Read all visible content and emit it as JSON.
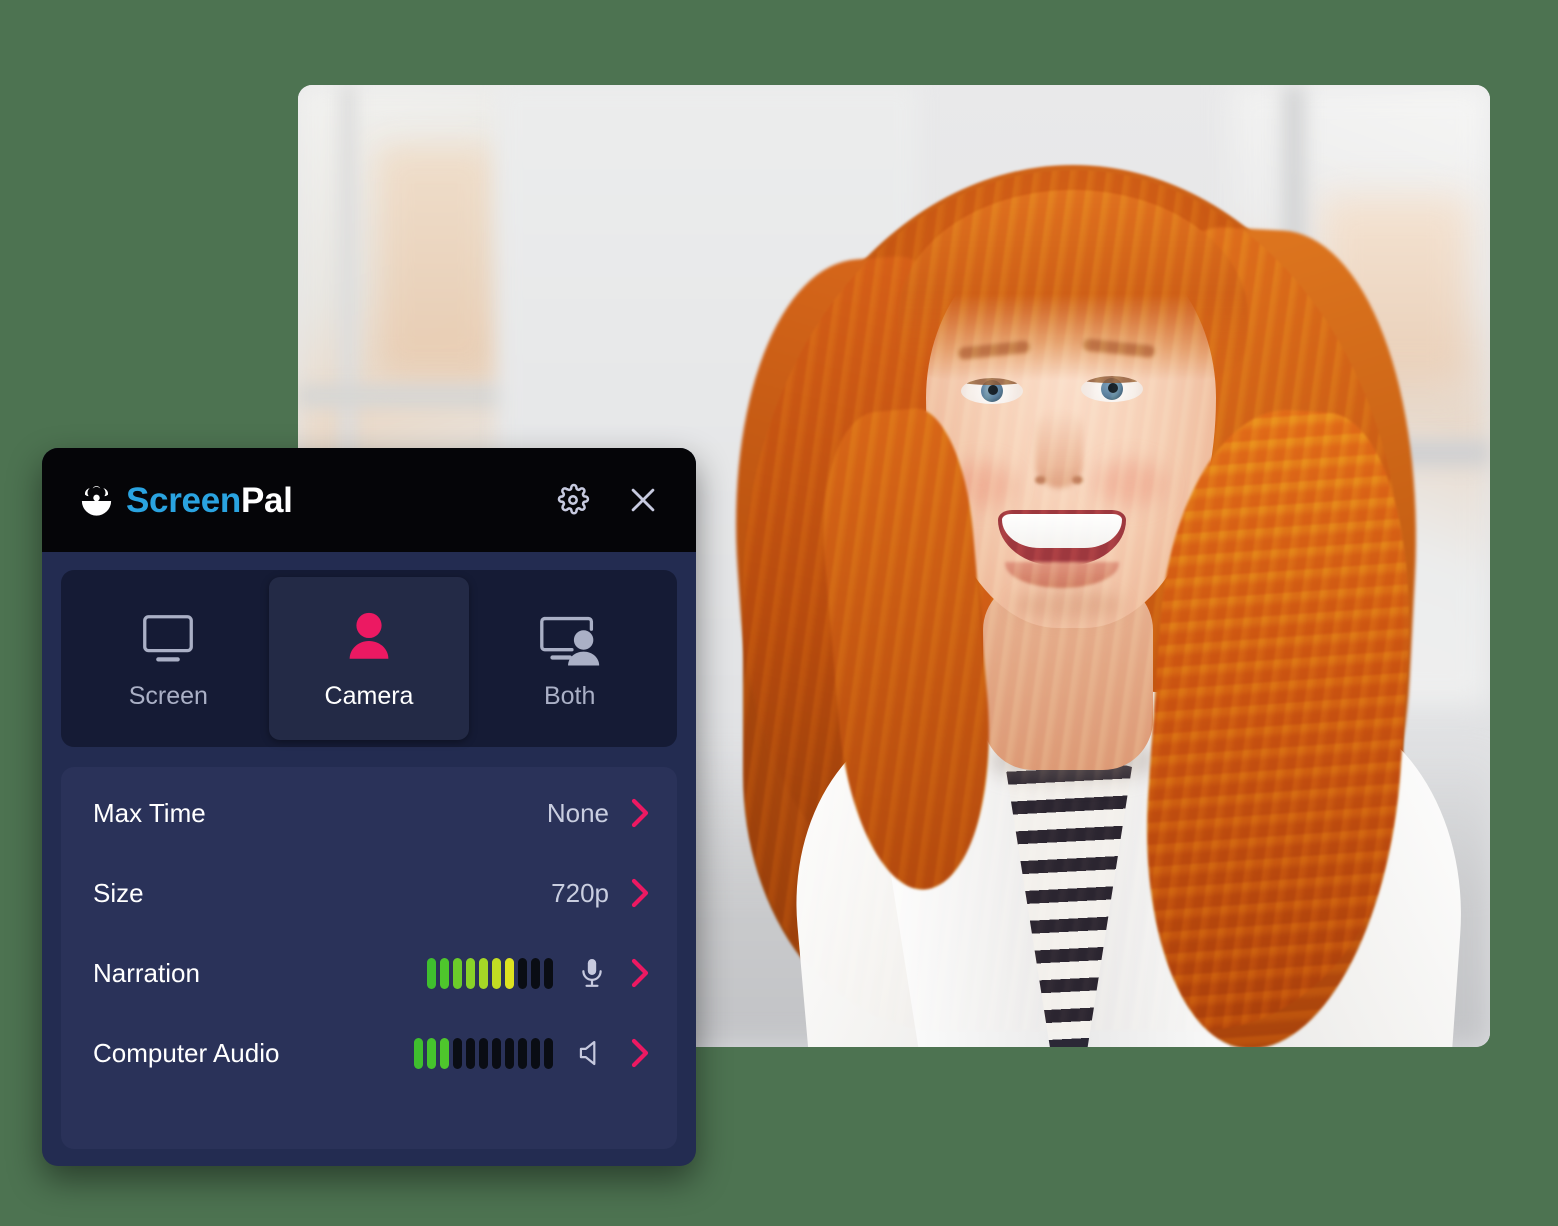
{
  "background_color": "#4d7351",
  "video_preview": {
    "name": "camera-preview",
    "alt": "Smiling woman with long red hair wearing a white blazer over a black and white striped shirt, seated in a bright office"
  },
  "recorder": {
    "titlebar": {
      "brand_first": "Screen",
      "brand_second": "Pal",
      "brand_first_color": "#2aa3e0",
      "brand_second_color": "#ffffff",
      "settings_icon": "gear-icon",
      "close_icon": "close-icon"
    },
    "modes": [
      {
        "label": "Screen",
        "icon": "monitor-icon",
        "active": false
      },
      {
        "label": "Camera",
        "icon": "person-icon",
        "active": true
      },
      {
        "label": "Both",
        "icon": "monitor-person-icon",
        "active": false
      }
    ],
    "active_mode": "Camera",
    "accent_color": "#ec1962",
    "settings": [
      {
        "label": "Max Time",
        "value": "None",
        "type": "value",
        "chevron": "chevron-right-icon"
      },
      {
        "label": "Size",
        "value": "720p",
        "type": "value",
        "chevron": "chevron-right-icon"
      },
      {
        "label": "Narration",
        "type": "meter",
        "icon": "microphone-icon",
        "chevron": "chevron-right-icon",
        "meter": {
          "total_bars": 10,
          "lit_bars": 7,
          "colors": [
            "#3fbf2e",
            "#4ec72c",
            "#6ccc2a",
            "#89d228",
            "#a5d726",
            "#c2dd23",
            "#dde321"
          ],
          "off_color": "#0a0d14"
        }
      },
      {
        "label": "Computer Audio",
        "type": "meter",
        "icon": "speaker-icon",
        "chevron": "chevron-right-icon",
        "meter": {
          "total_bars": 11,
          "lit_bars": 3,
          "colors": [
            "#3fbf2e",
            "#45c32d",
            "#4ec72c"
          ],
          "off_color": "#0a0d14"
        }
      }
    ]
  }
}
